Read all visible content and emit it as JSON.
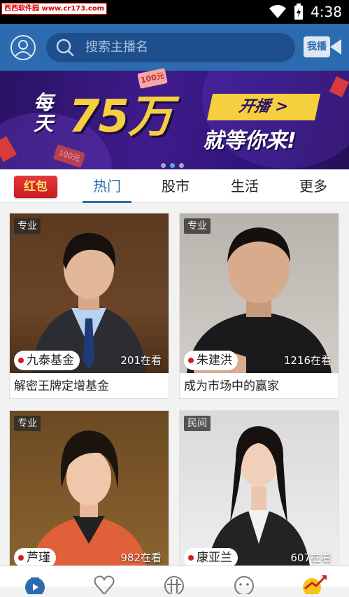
{
  "status_bar": {
    "watermark": "西西软件园 www.cr173.com",
    "time": "4:38"
  },
  "header": {
    "search_placeholder": "搜索主播名",
    "broadcast_label": "我播"
  },
  "banner": {
    "daily": "每天",
    "amount": "75万",
    "start_btn": "开播 >",
    "wait": "就等你来!",
    "tag": "100元",
    "tag2": "100元",
    "active_dot": 1
  },
  "tabs": {
    "redpack": "红包",
    "items": [
      "热门",
      "股市",
      "生活",
      "更多"
    ],
    "active": 0
  },
  "cards": [
    {
      "tag": "专业",
      "name": "九泰基金",
      "viewers": "201在看",
      "title": "解密王牌定增基金"
    },
    {
      "tag": "专业",
      "name": "朱建洪",
      "viewers": "1216在看",
      "title": "成为市场中的赢家"
    },
    {
      "tag": "专业",
      "name": "芦瑾",
      "viewers": "982在看",
      "title": ""
    },
    {
      "tag": "民间",
      "name": "康亚兰",
      "viewers": "607在看",
      "title": ""
    }
  ],
  "colors": {
    "primary": "#2c6bb0",
    "banner_gold": "#f5cf3e",
    "red": "#d71e1e"
  },
  "bottom_nav": [
    "live-icon",
    "heart-icon",
    "grid-icon",
    "chat-icon",
    "trend-icon"
  ]
}
